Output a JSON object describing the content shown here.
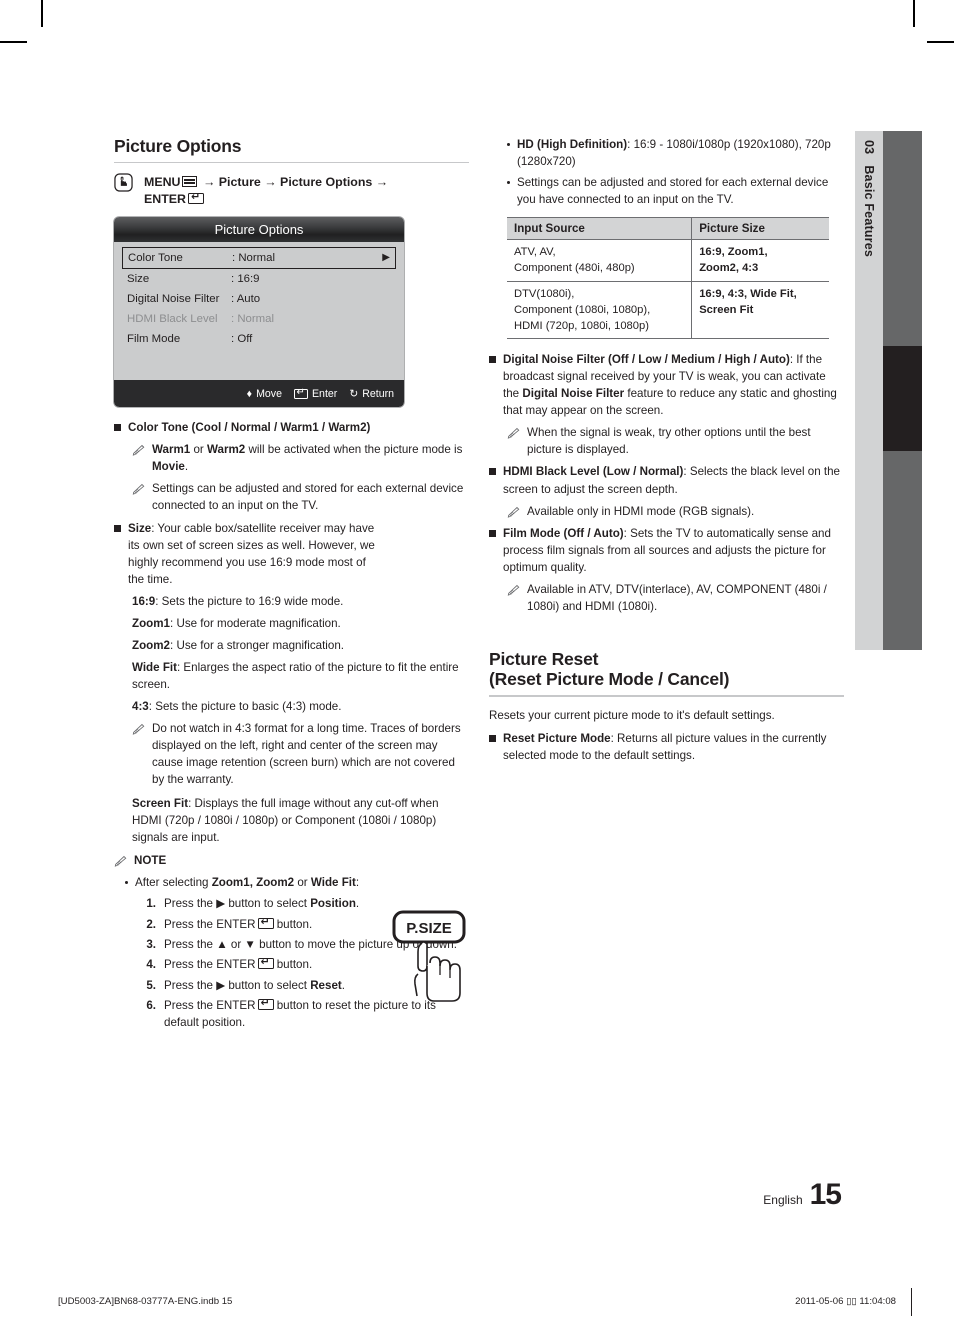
{
  "sidetab": {
    "number": "03",
    "label": "Basic Features"
  },
  "left": {
    "heading": "Picture Options",
    "menu_path": {
      "icon": "hand-press-icon",
      "line1_a": "MENU",
      "line1_b": "→ Picture → Picture Options →",
      "line2": "ENTER"
    },
    "osd": {
      "title": "Picture Options",
      "rows": [
        {
          "key": "Color Tone",
          "value": ": Normal",
          "selected": true,
          "dim": false,
          "arrow": "▶"
        },
        {
          "key": "Size",
          "value": ": 16:9",
          "selected": false,
          "dim": false,
          "arrow": ""
        },
        {
          "key": "Digital Noise Filter",
          "value": ": Auto",
          "selected": false,
          "dim": false,
          "arrow": ""
        },
        {
          "key": "HDMI Black Level",
          "value": ": Normal",
          "selected": false,
          "dim": true,
          "arrow": ""
        },
        {
          "key": "Film Mode",
          "value": ": Off",
          "selected": false,
          "dim": false,
          "arrow": ""
        }
      ],
      "footer": {
        "move": "Move",
        "enter": "Enter",
        "return": "Return"
      }
    },
    "color_tone": {
      "title_bold": "Color Tone (Cool / Normal / Warm1 / Warm2)",
      "note1_pre": "",
      "note1_b1": "Warm1",
      "note1_mid": " or ",
      "note1_b2": "Warm2",
      "note1_tail": " will be activated when the picture mode is ",
      "note1_b3": "Movie",
      "note1_end": ".",
      "note2": "Settings can be adjusted and stored for each external device connected to an input on the TV."
    },
    "size": {
      "label": "Size",
      "desc": ": Your cable box/satellite receiver may have its own set of screen sizes as well. However, we highly recommend you use 16:9 mode most of the time.",
      "modes": [
        {
          "name": "16:9",
          "desc": ": Sets the picture to 16:9 wide mode."
        },
        {
          "name": "Zoom1",
          "desc": ": Use for moderate magnification."
        },
        {
          "name": "Zoom2",
          "desc": ": Use for a stronger magnification."
        },
        {
          "name": "Wide Fit",
          "desc": ": Enlarges the aspect ratio of the picture to fit the entire screen."
        },
        {
          "name": "4:3",
          "desc": ": Sets the picture to basic (4:3) mode."
        }
      ],
      "warning": "Do not watch in 4:3 format for a long time. Traces of borders displayed on the left, right and center of the screen may cause image retention (screen burn) which are not covered by the warranty.",
      "screen_fit_name": "Screen Fit",
      "screen_fit_desc": ": Displays the full image without any cut-off when HDMI (720p / 1080i / 1080p) or Component (1080i / 1080p) signals are input."
    },
    "note_block": {
      "title": "NOTE",
      "bullet_pre": "After selecting ",
      "bullet_b": "Zoom1, Zoom2",
      "bullet_mid": " or ",
      "bullet_b2": "Wide Fit",
      "bullet_end": ":",
      "steps": [
        {
          "n": "1.",
          "pre": "Press the ▶ button to select ",
          "b": "Position",
          "post": "."
        },
        {
          "n": "2.",
          "pre": "Press the ENTER",
          "b": "",
          "post": " button."
        },
        {
          "n": "3.",
          "pre": "Press the ▲ or ▼ button to move the picture up or down.",
          "b": "",
          "post": ""
        },
        {
          "n": "4.",
          "pre": "Press the ENTER",
          "b": "",
          "post": " button."
        },
        {
          "n": "5.",
          "pre": "Press the ▶ button to select ",
          "b": "Reset",
          "post": "."
        },
        {
          "n": "6.",
          "pre": "Press the ENTER",
          "b": "",
          "post": " button to reset the picture to its default position."
        }
      ]
    },
    "psize_button": "P.SIZE"
  },
  "right": {
    "bullets": [
      {
        "pre": "",
        "b": "HD (High Definition)",
        "post": ": 16:9 - 1080i/1080p (1920x1080), 720p (1280x720)"
      },
      {
        "pre": "Settings can be adjusted and stored for each external device you have connected to an input on the TV.",
        "b": "",
        "post": ""
      }
    ],
    "table": {
      "headers": [
        "Input Source",
        "Picture Size"
      ],
      "rows": [
        {
          "source": "ATV, AV,\nComponent (480i, 480p)",
          "size": "16:9, Zoom1,\nZoom2, 4:3"
        },
        {
          "source": "DTV(1080i),\nComponent (1080i, 1080p),\nHDMI (720p, 1080i, 1080p)",
          "size": "16:9, 4:3, Wide Fit,\nScreen Fit"
        }
      ]
    },
    "dnf": {
      "title": "Digital Noise Filter (Off / Low / Medium / High / Auto)",
      "desc_pre": ": If the broadcast signal received by your TV is weak, you can activate the ",
      "desc_b": "Digital Noise Filter",
      "desc_post": " feature to reduce any static and ghosting that may appear on the screen.",
      "note": "When the signal is weak, try other options until the best picture is displayed."
    },
    "hdmi": {
      "title": "HDMI Black Level (Low / Normal)",
      "desc": ": Selects the black level on the screen to adjust the screen depth.",
      "note": "Available only in HDMI mode (RGB signals)."
    },
    "film": {
      "title": "Film Mode (Off / Auto)",
      "desc": ": Sets the TV to automatically sense and process film signals from all sources and adjusts the picture for optimum quality.",
      "note": "Available in ATV, DTV(interlace), AV, COMPONENT (480i / 1080i) and HDMI (1080i)."
    },
    "reset": {
      "heading_line1": "Picture Reset",
      "heading_line2": "(Reset Picture Mode / Cancel)",
      "intro": "Resets your current picture mode to it's default settings.",
      "item_b": "Reset Picture Mode",
      "item_post": ": Returns all picture values in the currently selected mode to the default settings."
    }
  },
  "page_footer": {
    "language": "English",
    "page_number": "15",
    "file_name": "[UD5003-ZA]BN68-03777A-ENG.indb   15",
    "timestamp": "2011-05-06   ▯▯ 11:04:08"
  }
}
